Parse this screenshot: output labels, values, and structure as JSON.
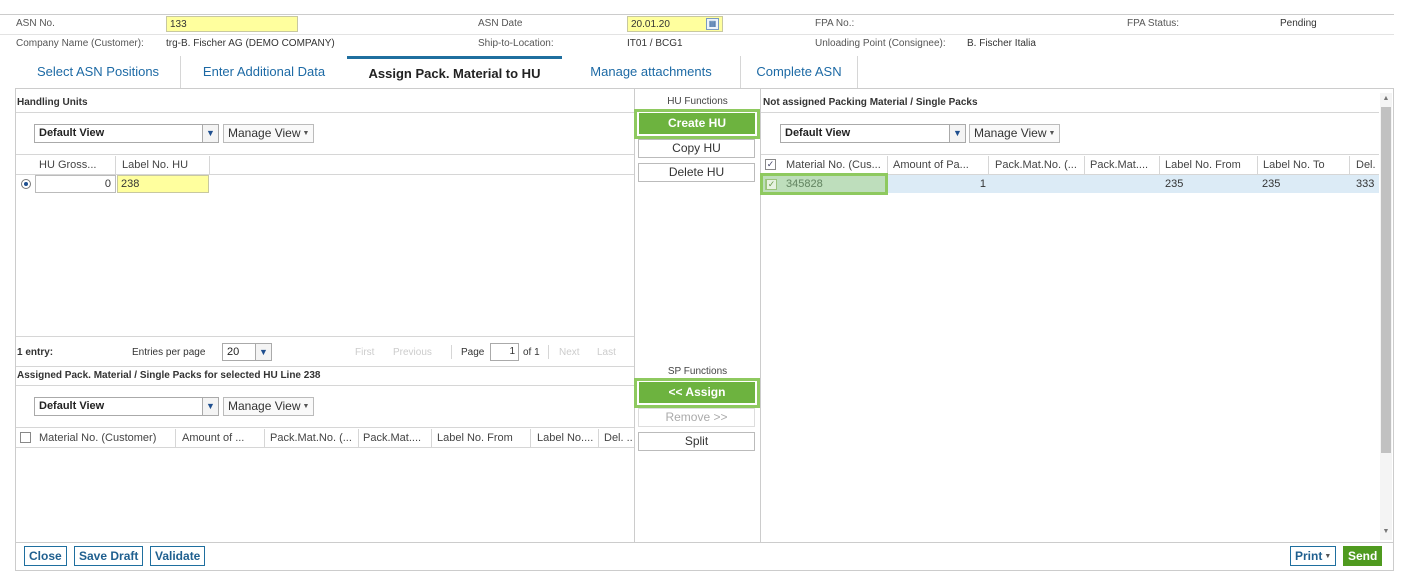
{
  "header": {
    "asn_no_label": "ASN No.",
    "asn_no_value": "133",
    "asn_date_label": "ASN Date",
    "asn_date_value": "20.01.20",
    "fpa_no_label": "FPA No.:",
    "fpa_status_label": "FPA Status:",
    "fpa_status_value": "Pending",
    "company_label": "Company Name (Customer):",
    "company_value": "trg-B. Fischer AG (DEMO COMPANY)",
    "ship_to_label": "Ship-to-Location:",
    "ship_to_value": "IT01 / BCG1",
    "unloading_label": "Unloading Point (Consignee):",
    "unloading_value": "B. Fischer Italia"
  },
  "tabs": [
    {
      "label": "Select ASN Positions"
    },
    {
      "label": "Enter Additional Data"
    },
    {
      "label": "Assign Pack. Material to HU"
    },
    {
      "label": "Manage attachments"
    },
    {
      "label": "Complete ASN"
    }
  ],
  "handling_units": {
    "title": "Handling Units",
    "view": "Default View",
    "manage_view": "Manage View",
    "columns": [
      "HU Gross...",
      "Label No. HU"
    ],
    "row": {
      "gross": "0",
      "label": "238"
    },
    "pager": {
      "entries": "1 entry:",
      "per_page_label": "Entries per page",
      "per_page": "20",
      "first": "First",
      "previous": "Previous",
      "page_label": "Page",
      "page": "1",
      "of": "of 1",
      "next": "Next",
      "last": "Last"
    }
  },
  "hu_functions": {
    "title": "HU Functions",
    "create": "Create HU",
    "copy": "Copy HU",
    "delete": "Delete HU"
  },
  "sp_functions": {
    "title": "SP Functions",
    "assign": "<< Assign",
    "remove": "Remove >>",
    "split": "Split"
  },
  "assigned": {
    "title": "Assigned Pack. Material / Single Packs for selected HU Line 238",
    "view": "Default View",
    "manage_view": "Manage View",
    "columns": [
      "Material No. (Customer)",
      "Amount of ...",
      "Pack.Mat.No. (...",
      "Pack.Mat....",
      "Label No. From",
      "Label No....",
      "Del. ..."
    ]
  },
  "not_assigned": {
    "title": "Not assigned Packing Material / Single Packs",
    "view": "Default View",
    "manage_view": "Manage View",
    "columns": [
      "Material No. (Cus...",
      "Amount of Pa...",
      "Pack.Mat.No. (...",
      "Pack.Mat....",
      "Label No. From",
      "Label No. To",
      "Del."
    ],
    "row": {
      "material": "345828",
      "amount": "1",
      "label_from": "235",
      "label_to": "235",
      "del": "333"
    }
  },
  "footer": {
    "close": "Close",
    "save_draft": "Save Draft",
    "validate": "Validate",
    "print": "Print",
    "send": "Send"
  },
  "colors": {
    "accent": "#6db33f",
    "link": "#1d6aa5",
    "highlight": "#ffff9e",
    "selected_row": "#dcebf6"
  }
}
